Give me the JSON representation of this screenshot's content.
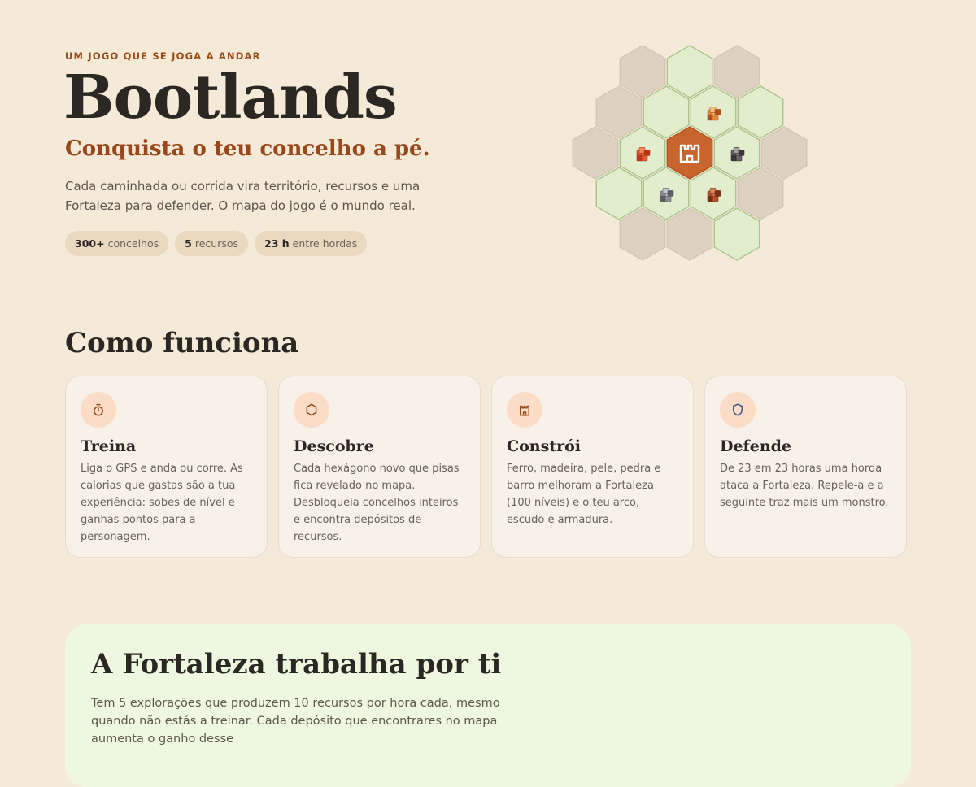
{
  "hero": {
    "eyebrow": "UM JOGO QUE SE JOGA A ANDAR",
    "title": "Bootlands",
    "tagline": "Conquista o teu concelho a pé.",
    "description": "Cada caminhada ou corrida vira território, recursos e uma Fortaleza para defender. O mapa do jogo é o mundo real.",
    "stats": [
      {
        "value": "300+",
        "label": "concelhos"
      },
      {
        "value": "5",
        "label": "recursos"
      },
      {
        "value": "23 h",
        "label": "entre hordas"
      }
    ]
  },
  "hex_map": {
    "colors": {
      "unexplored": "#ddd2c2",
      "explored": "#e1edcc",
      "fortress": "#c8652f",
      "explored_border": "#a9c48b"
    },
    "tiles": [
      {
        "state": "unexplored"
      },
      {
        "state": "explored"
      },
      {
        "state": "unexplored"
      },
      {
        "state": "unexplored"
      },
      {
        "state": "explored"
      },
      {
        "state": "explored",
        "resource": "wood-icon"
      },
      {
        "state": "explored"
      },
      {
        "state": "unexplored"
      },
      {
        "state": "explored",
        "resource": "clay-icon"
      },
      {
        "state": "fortress",
        "resource": "castle-icon"
      },
      {
        "state": "explored",
        "resource": "iron-ore-icon"
      },
      {
        "state": "unexplored"
      },
      {
        "state": "explored"
      },
      {
        "state": "explored",
        "resource": "stone-icon"
      },
      {
        "state": "explored",
        "resource": "leather-icon"
      },
      {
        "state": "unexplored"
      },
      {
        "state": "unexplored"
      },
      {
        "state": "unexplored"
      },
      {
        "state": "explored"
      }
    ]
  },
  "how": {
    "title": "Como funciona",
    "cards": [
      {
        "icon": "stopwatch-icon",
        "title": "Treina",
        "text": "Liga o GPS e anda ou corre. As calorias que gastas são a tua experiência: sobes de nível e ganhas pontos para a personagem."
      },
      {
        "icon": "hexagon-icon",
        "title": "Descobre",
        "text": "Cada hexágono novo que pisas fica revelado no mapa. Desbloqueia concelhos inteiros e encontra depósitos de recursos."
      },
      {
        "icon": "castle-icon",
        "title": "Constrói",
        "text": "Ferro, madeira, pele, pedra e barro melhoram a Fortaleza (100 níveis) e o teu arco, escudo e armadura."
      },
      {
        "icon": "shield-icon",
        "title": "Defende",
        "text": "De 23 em 23 horas uma horda ataca a Fortaleza. Repele-a e a seguinte traz mais um monstro."
      }
    ]
  },
  "fortress": {
    "title": "A Fortaleza trabalha por ti",
    "text": "Tem 5 explorações que produzem 10 recursos por hora cada, mesmo quando não estás a treinar. Cada depósito que encontrares no mapa aumenta o ganho desse"
  }
}
